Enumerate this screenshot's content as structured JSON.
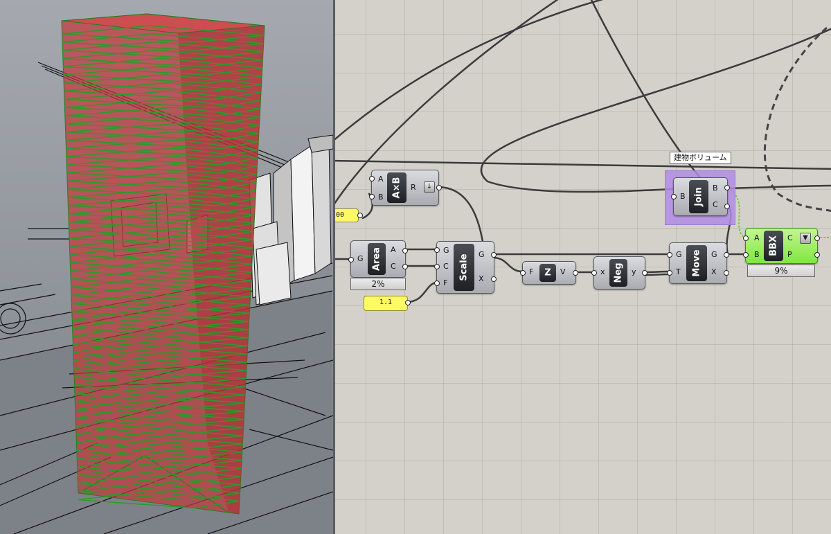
{
  "panel_value_left": "00",
  "panel_value_scale": "1.1",
  "group": {
    "label": "建物ボリューム"
  },
  "components": {
    "multiply": {
      "nick": "A×B",
      "inputs": [
        "A",
        "B"
      ],
      "outputs": [
        "R"
      ]
    },
    "area": {
      "nick": "Area",
      "inputs": [
        "G"
      ],
      "outputs": [
        "A",
        "C"
      ],
      "progress": "2%"
    },
    "scale": {
      "nick": "Scale",
      "inputs": [
        "G",
        "C",
        "F"
      ],
      "outputs": [
        "G",
        "X"
      ]
    },
    "unit_z": {
      "nick": "Z",
      "inputs": [
        "F"
      ],
      "outputs": [
        "V"
      ]
    },
    "negative": {
      "nick": "Neg",
      "inputs": [
        "x"
      ],
      "outputs": [
        "y"
      ]
    },
    "move": {
      "nick": "Move",
      "inputs": [
        "G",
        "T"
      ],
      "outputs": [
        "G",
        "X"
      ]
    },
    "join": {
      "nick": "Join",
      "inputs": [
        "B"
      ],
      "outputs": [
        "B",
        "C"
      ]
    },
    "bbx": {
      "nick": "BBX",
      "inputs": [
        "A",
        "B"
      ],
      "outputs": [
        "C",
        "P"
      ],
      "progress": "9%"
    }
  },
  "icons": {
    "flatten": "arrow-down-icon",
    "filter": "funnel-icon"
  },
  "colors": {
    "canvas": "#d4d1ca",
    "preview_red": "#c0393d",
    "preview_green": "#2b9a2b",
    "selected_green": "#7fe73f",
    "group_purple": "#b18ce5",
    "panel_yellow": "#fdfa66"
  }
}
